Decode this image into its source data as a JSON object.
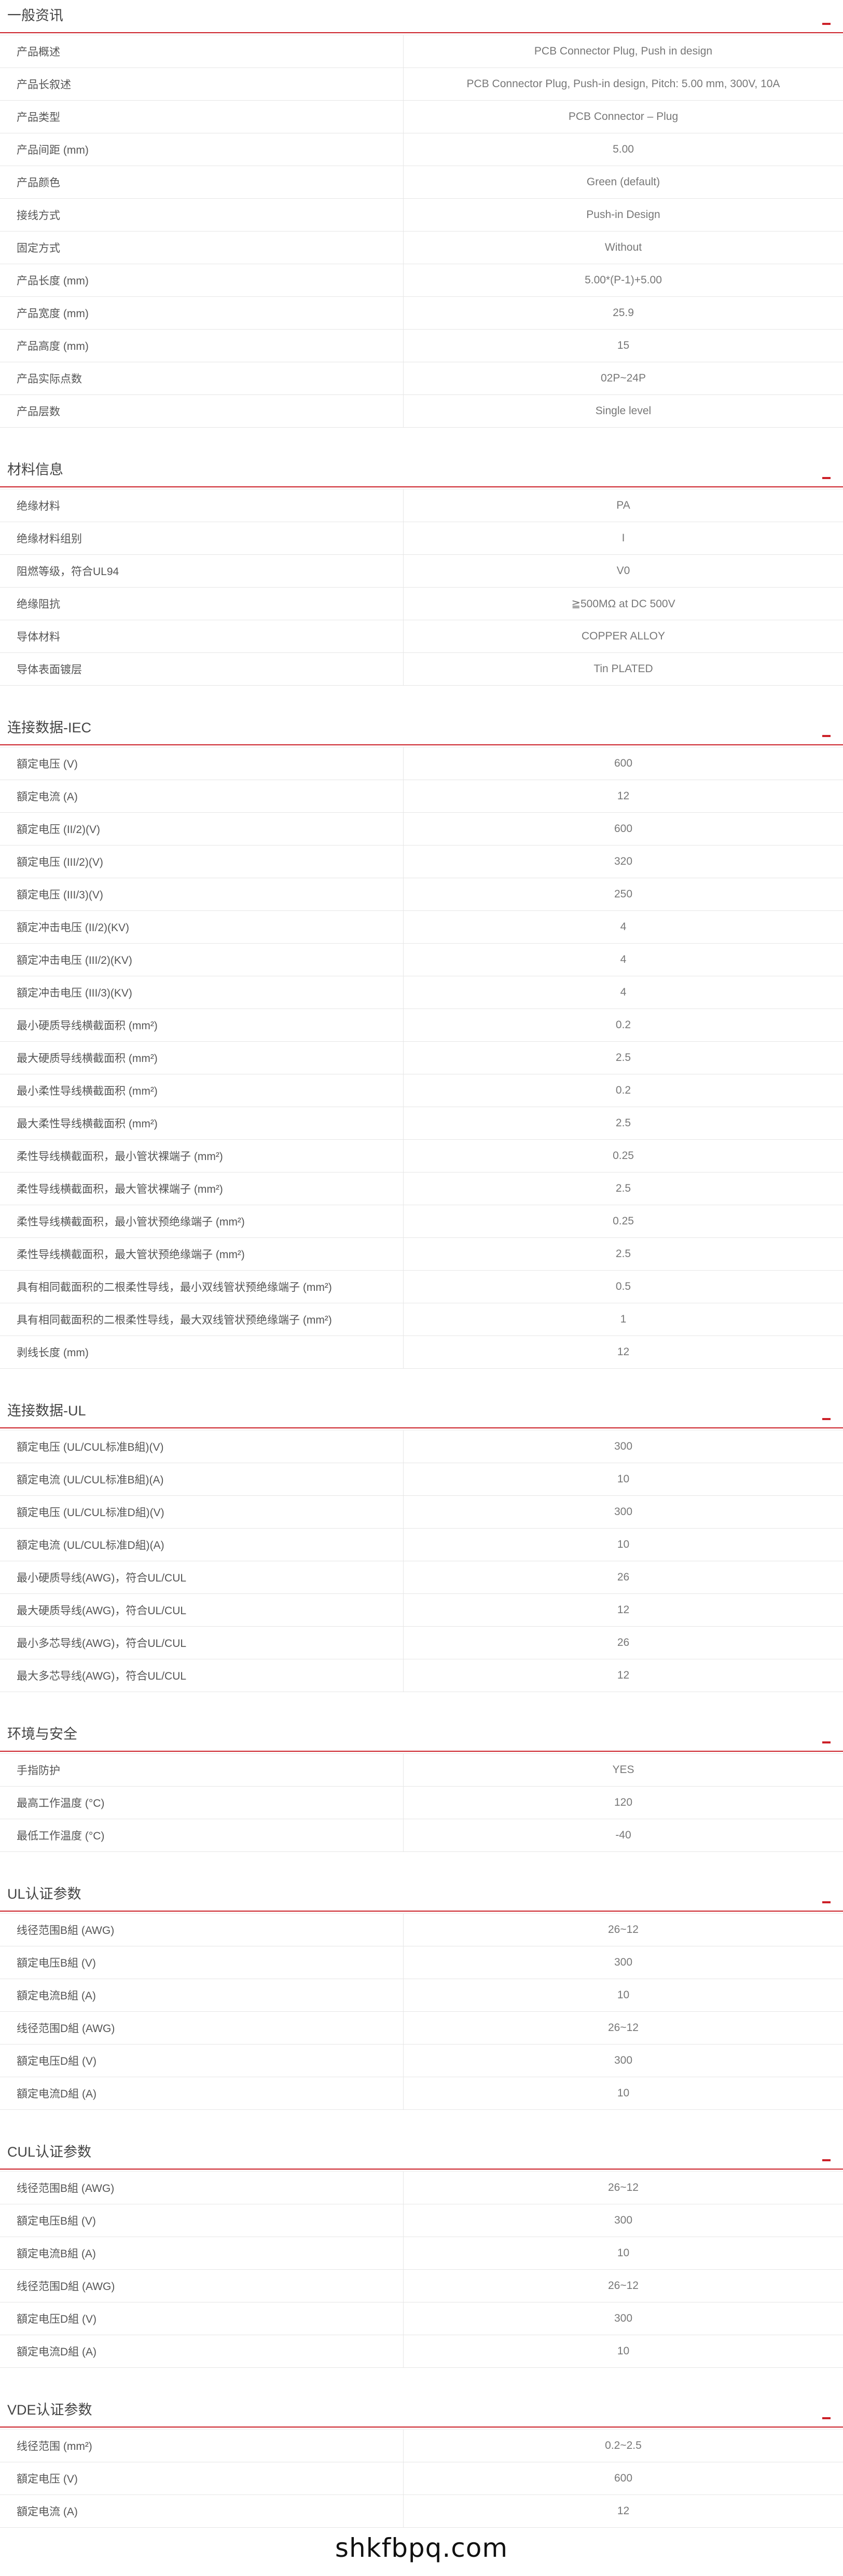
{
  "sections": [
    {
      "title": "一般资讯",
      "rows": [
        {
          "label": "产品概述",
          "value": "PCB Connector Plug, Push in design"
        },
        {
          "label": "产品长叙述",
          "value": "PCB Connector Plug, Push-in design, Pitch: 5.00 mm, 300V, 10A"
        },
        {
          "label": "产品类型",
          "value": "PCB Connector – Plug"
        },
        {
          "label": "产品间距 (mm)",
          "value": "5.00"
        },
        {
          "label": "产品颜色",
          "value": "Green (default)"
        },
        {
          "label": "接线方式",
          "value": "Push-in Design"
        },
        {
          "label": "固定方式",
          "value": "Without"
        },
        {
          "label": "产品长度 (mm)",
          "value": "5.00*(P-1)+5.00"
        },
        {
          "label": "产品宽度 (mm)",
          "value": "25.9"
        },
        {
          "label": "产品高度 (mm)",
          "value": "15"
        },
        {
          "label": "产品实际点数",
          "value": "02P~24P"
        },
        {
          "label": "产品层数",
          "value": "Single level"
        }
      ]
    },
    {
      "title": "材料信息",
      "rows": [
        {
          "label": "绝缘材料",
          "value": "PA"
        },
        {
          "label": "绝缘材料组别",
          "value": "I"
        },
        {
          "label": "阻燃等级，符合UL94",
          "value": "V0"
        },
        {
          "label": "绝缘阻抗",
          "value": "≧500MΩ at DC 500V"
        },
        {
          "label": "导体材料",
          "value": "COPPER ALLOY"
        },
        {
          "label": "导体表面镀层",
          "value": "Tin PLATED"
        }
      ]
    },
    {
      "title": "连接数据-IEC",
      "rows": [
        {
          "label": "額定电压 (V)",
          "value": "600"
        },
        {
          "label": "額定电流 (A)",
          "value": "12"
        },
        {
          "label": "額定电压 (II/2)(V)",
          "value": "600"
        },
        {
          "label": "額定电压 (III/2)(V)",
          "value": "320"
        },
        {
          "label": "額定电压 (III/3)(V)",
          "value": "250"
        },
        {
          "label": "額定冲击电压 (II/2)(KV)",
          "value": "4"
        },
        {
          "label": "額定冲击电压 (III/2)(KV)",
          "value": "4"
        },
        {
          "label": "額定冲击电压 (III/3)(KV)",
          "value": "4"
        },
        {
          "label": "最小硬质导线横截面积 (mm²)",
          "value": "0.2"
        },
        {
          "label": "最大硬质导线横截面积 (mm²)",
          "value": "2.5"
        },
        {
          "label": "最小柔性导线横截面积 (mm²)",
          "value": "0.2"
        },
        {
          "label": "最大柔性导线横截面积 (mm²)",
          "value": "2.5"
        },
        {
          "label": "柔性导线横截面积，最小管状裸端子 (mm²)",
          "value": "0.25"
        },
        {
          "label": "柔性导线横截面积，最大管状裸端子 (mm²)",
          "value": "2.5"
        },
        {
          "label": "柔性导线横截面积，最小管状预绝缘端子 (mm²)",
          "value": "0.25"
        },
        {
          "label": "柔性导线横截面积，最大管状预绝缘端子 (mm²)",
          "value": "2.5"
        },
        {
          "label": "具有相同截面积的二根柔性导线，最小双线管状预绝缘端子 (mm²)",
          "value": "0.5"
        },
        {
          "label": "具有相同截面积的二根柔性导线，最大双线管状预绝缘端子 (mm²)",
          "value": "1"
        },
        {
          "label": "剥线长度 (mm)",
          "value": "12"
        }
      ]
    },
    {
      "title": "连接数据-UL",
      "rows": [
        {
          "label": "額定电压 (UL/CUL标准B組)(V)",
          "value": "300"
        },
        {
          "label": "額定电流 (UL/CUL标准B組)(A)",
          "value": "10"
        },
        {
          "label": "額定电压 (UL/CUL标准D組)(V)",
          "value": "300"
        },
        {
          "label": "額定电流 (UL/CUL标准D組)(A)",
          "value": "10"
        },
        {
          "label": "最小硬质导线(AWG)，符合UL/CUL",
          "value": "26"
        },
        {
          "label": "最大硬质导线(AWG)，符合UL/CUL",
          "value": "12"
        },
        {
          "label": "最小多芯导线(AWG)，符合UL/CUL",
          "value": "26"
        },
        {
          "label": "最大多芯导线(AWG)，符合UL/CUL",
          "value": "12"
        }
      ]
    },
    {
      "title": "环境与安全",
      "rows": [
        {
          "label": "手指防护",
          "value": "YES"
        },
        {
          "label": "最高工作温度 (°C)",
          "value": "120"
        },
        {
          "label": "最低工作温度 (°C)",
          "value": "-40"
        }
      ]
    },
    {
      "title": "UL认证参数",
      "rows": [
        {
          "label": "线径范围B組 (AWG)",
          "value": "26~12"
        },
        {
          "label": "額定电压B組 (V)",
          "value": "300"
        },
        {
          "label": "額定电流B組 (A)",
          "value": "10"
        },
        {
          "label": "线径范围D組 (AWG)",
          "value": "26~12"
        },
        {
          "label": "額定电压D組 (V)",
          "value": "300"
        },
        {
          "label": "額定电流D組 (A)",
          "value": "10"
        }
      ]
    },
    {
      "title": "CUL认证参数",
      "rows": [
        {
          "label": "线径范围B組 (AWG)",
          "value": "26~12"
        },
        {
          "label": "額定电压B組 (V)",
          "value": "300"
        },
        {
          "label": "額定电流B組 (A)",
          "value": "10"
        },
        {
          "label": "线径范围D組 (AWG)",
          "value": "26~12"
        },
        {
          "label": "額定电压D組 (V)",
          "value": "300"
        },
        {
          "label": "額定电流D組 (A)",
          "value": "10"
        }
      ]
    },
    {
      "title": "VDE认证参数",
      "rows": [
        {
          "label": "线径范围 (mm²)",
          "value": "0.2~2.5"
        },
        {
          "label": "額定电压 (V)",
          "value": "600"
        },
        {
          "label": "額定电流 (A)",
          "value": "12"
        }
      ]
    }
  ],
  "watermark": "shkfbpq.com",
  "colors": {
    "accent": "#cc2028",
    "border": "#e6e6e6",
    "label_text": "#555555",
    "value_text": "#777777"
  },
  "icons": {
    "section_toggle": "collapse-icon"
  }
}
